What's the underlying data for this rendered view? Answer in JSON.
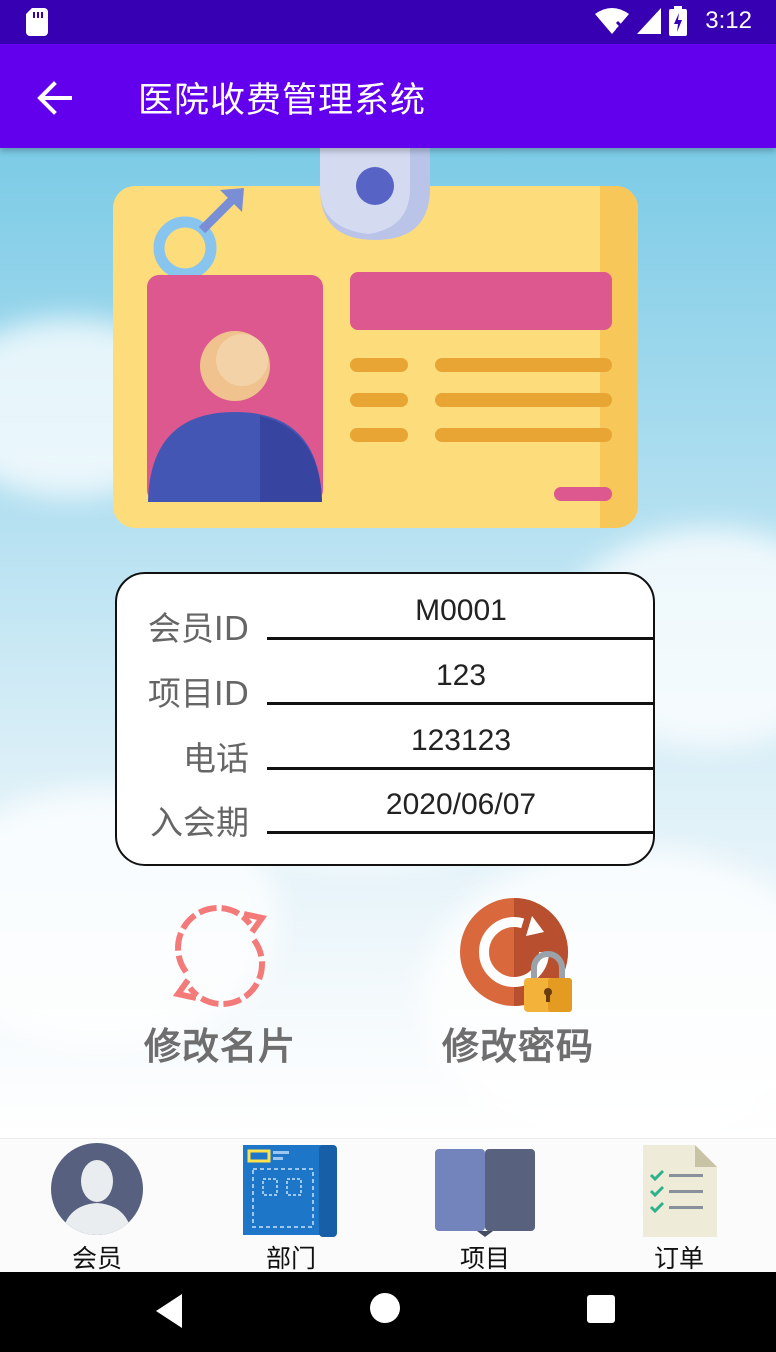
{
  "status_bar": {
    "time": "3:12",
    "icons": [
      "sd-card-icon",
      "wifi-icon",
      "signal-icon",
      "battery-charging-icon"
    ]
  },
  "app_bar": {
    "title": "医院收费管理系统",
    "back_icon": "arrow-left-icon"
  },
  "member_info": {
    "rows": [
      {
        "label": "会员ID",
        "value": "M0001"
      },
      {
        "label": "项目ID",
        "value": "123"
      },
      {
        "label": "电话",
        "value": "123123"
      },
      {
        "label": "入会期",
        "value": "2020/06/07"
      }
    ]
  },
  "actions": {
    "edit_card": {
      "label": "修改名片",
      "icon": "refresh-icon"
    },
    "change_password": {
      "label": "修改密码",
      "icon": "lock-reset-icon"
    }
  },
  "bottom_nav": [
    {
      "label": "会员",
      "icon": "member-avatar-icon"
    },
    {
      "label": "部门",
      "icon": "department-blueprint-icon"
    },
    {
      "label": "项目",
      "icon": "project-book-icon"
    },
    {
      "label": "订单",
      "icon": "order-checklist-icon"
    }
  ],
  "colors": {
    "status_bar": "#3700b3",
    "app_bar": "#6200ee",
    "card_yellow": "#fddc7b",
    "card_pink": "#dc588f"
  }
}
